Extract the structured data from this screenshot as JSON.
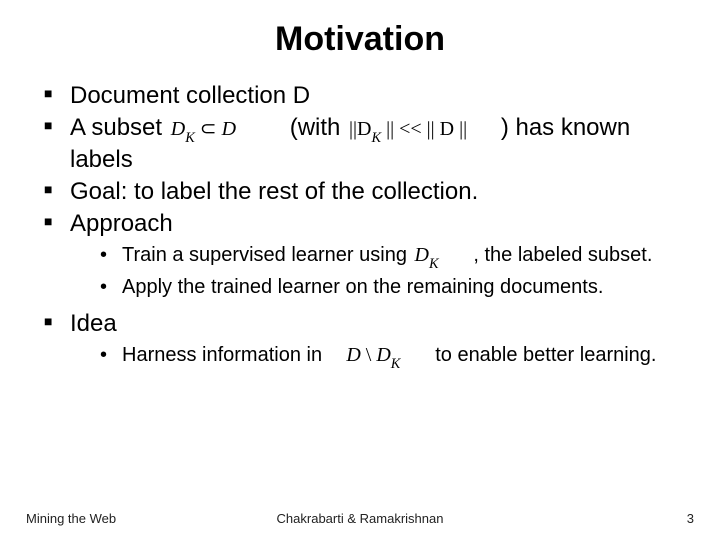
{
  "title": "Motivation",
  "bullets": {
    "b1": "Document collection D",
    "b2_a": "A subset",
    "b2_math1_left": "D",
    "b2_math1_sub": "K",
    "b2_math1_rel": " ⊂ ",
    "b2_math1_right": "D",
    "b2_b": "(with",
    "b2_math2_a": "||D",
    "b2_math2_sub": "K",
    "b2_math2_b": " || << || D ||",
    "b2_c": ") has known labels",
    "b3": "Goal: to label the rest of the collection.",
    "b4": "Approach",
    "b4_1a": "Train a supervised learner using",
    "b4_1_math_left": "D",
    "b4_1_math_sub": "K",
    "b4_1b": ", the labeled subset.",
    "b4_2": "Apply the trained learner on the remaining documents.",
    "b5": "Idea",
    "b5_1a": "Harness information in",
    "b5_1_math_a": "D",
    "b5_1_math_op": " \\ ",
    "b5_1_math_b": "D",
    "b5_1_math_sub": "K",
    "b5_1b": "to enable better learning."
  },
  "footer": {
    "left": "Mining the Web",
    "center": "Chakrabarti & Ramakrishnan",
    "page": "3"
  }
}
